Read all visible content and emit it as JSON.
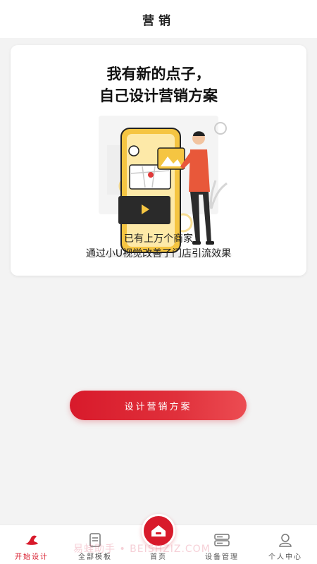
{
  "header": {
    "title": "营销"
  },
  "card": {
    "headline_line1": "我有新的点子，",
    "headline_line2": "自己设计营销方案",
    "illustration_icon": "person-phone-illustration",
    "subtext_line1": "已有上万个商家",
    "subtext_line2": "通过小U视觉改善了门店引流效果"
  },
  "cta": {
    "label": "设计营销方案"
  },
  "tabbar": {
    "tabs": [
      {
        "label": "开始设计",
        "icon": "shoe-icon",
        "active": true
      },
      {
        "label": "全部模板",
        "icon": "document-icon",
        "active": false
      },
      {
        "label": "首页",
        "icon": "home-icon",
        "active": false
      },
      {
        "label": "设备管理",
        "icon": "server-icon",
        "active": false
      },
      {
        "label": "个人中心",
        "icon": "user-icon",
        "active": false
      }
    ]
  },
  "watermark": {
    "text": "易蛙助手 • BEISHZIZ.COM"
  },
  "colors": {
    "accent": "#d81a2b",
    "background": "#f3f3f3"
  }
}
